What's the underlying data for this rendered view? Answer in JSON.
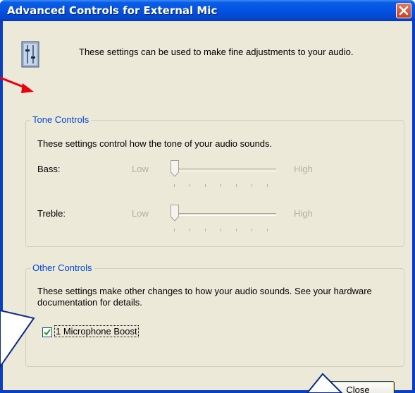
{
  "window": {
    "title": "Advanced Controls for External Mic",
    "intro": "These settings can be used to make fine adjustments to your audio."
  },
  "tone_controls": {
    "legend": "Tone Controls",
    "description": "These settings control how the tone of your audio sounds.",
    "bass": {
      "label": "Bass:",
      "low": "Low",
      "high": "High",
      "level": 0.0
    },
    "treble": {
      "label": "Treble:",
      "low": "Low",
      "high": "High",
      "level": 0.0
    }
  },
  "other_controls": {
    "legend": "Other Controls",
    "description": "These settings make other changes to how your audio sounds.  See your hardware documentation for details.",
    "mic_boost": {
      "label": "1  Microphone Boost",
      "checked": true
    }
  },
  "buttons": {
    "close": "Close"
  },
  "colors": {
    "titlebar": "#0454e3",
    "legend_text": "#0046d5",
    "arrow": "#e8000d",
    "callout": "#0a2a8a"
  },
  "icons": [
    "info-panel-icon",
    "close-x-icon",
    "checkmark-icon"
  ]
}
